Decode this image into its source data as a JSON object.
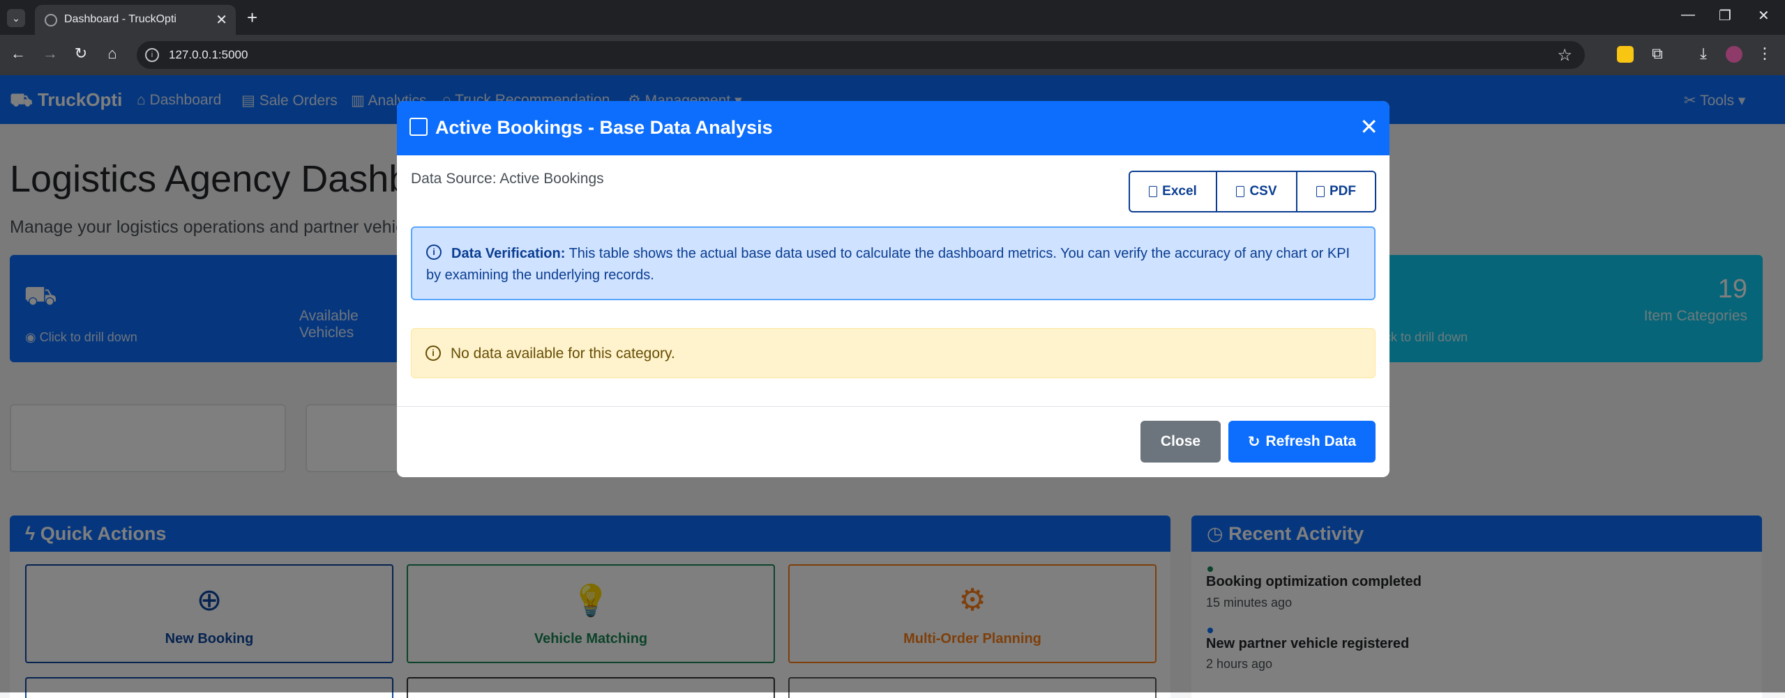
{
  "browser": {
    "tab_title": "Dashboard - TruckOpti",
    "url": "127.0.0.1:5000",
    "new_tab": "+",
    "close_tab": "✕"
  },
  "app": {
    "brand": "TruckOpti",
    "nav": {
      "dashboard": "Dashboard",
      "sale_orders": "Sale Orders",
      "analytics": "Analytics",
      "truck_recommendation": "Truck Recommendation",
      "management": "Management",
      "tools": "Tools"
    },
    "page_title": "Logistics Agency Dashboard",
    "page_subtitle": "Manage your logistics operations and partner vehicles",
    "kpi": {
      "vehicles_label": "Available Vehicles",
      "drill_hint_left": "Click to drill down",
      "categories_value": "19",
      "categories_label": "Item Categories",
      "drill_hint_right": "Click to drill down"
    },
    "quick_actions": {
      "title": "Quick Actions",
      "items": [
        {
          "label": "New Booking",
          "color": "#0d47a1"
        },
        {
          "label": "Vehicle Matching",
          "color": "#198754"
        },
        {
          "label": "Multi-Order Planning",
          "color": "#fd7e14"
        }
      ]
    },
    "recent_activity": {
      "title": "Recent Activity",
      "items": [
        {
          "title": "Booking optimization completed",
          "time": "15 minutes ago",
          "dot": "#198754"
        },
        {
          "title": "New partner vehicle registered",
          "time": "2 hours ago",
          "dot": "#0d6efd"
        }
      ]
    }
  },
  "modal": {
    "title": "Active Bookings - Base Data Analysis",
    "data_source": "Data Source: Active Bookings",
    "export": {
      "excel": "Excel",
      "csv": "CSV",
      "pdf": "PDF"
    },
    "info_strong": "Data Verification:",
    "info_text": "This table shows the actual base data used to calculate the dashboard metrics. You can verify the accuracy of any chart or KPI by examining the underlying records.",
    "warning": "No data available for this category.",
    "close_label": "Close",
    "refresh_label": "Refresh Data"
  },
  "colors": {
    "primary": "#0d6efd",
    "info": "#0dcaf0",
    "secondary": "#6c757d",
    "warning_bg": "#fff3cd"
  }
}
